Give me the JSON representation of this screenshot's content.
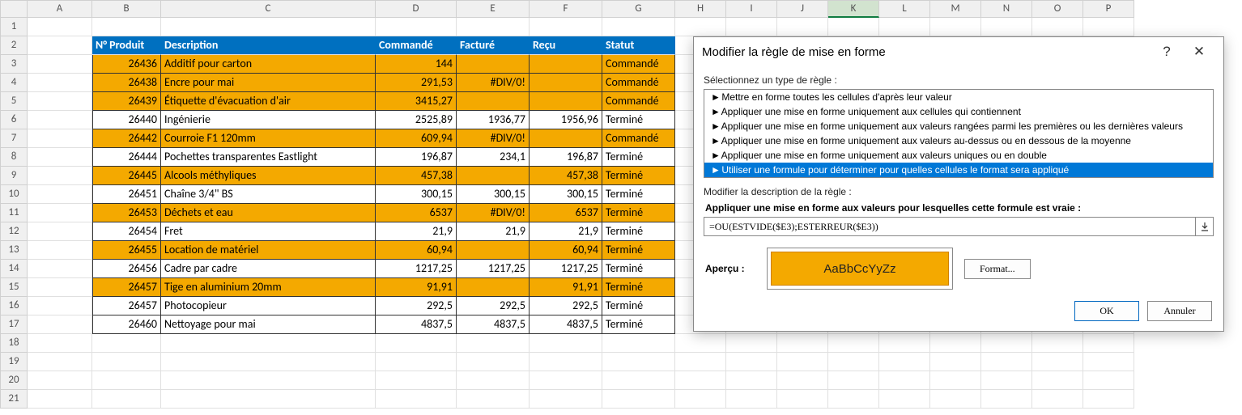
{
  "columns": [
    "A",
    "B",
    "C",
    "D",
    "E",
    "F",
    "G",
    "H",
    "I",
    "J",
    "K",
    "L",
    "M",
    "N",
    "O",
    "P"
  ],
  "selected_column": "K",
  "headers": {
    "B": "N° Produit",
    "C": "Description",
    "D": "Commandé",
    "E": "Facturé",
    "F": "Reçu",
    "G": "Statut"
  },
  "rows": [
    {
      "n": "26436",
      "desc": "Additif pour carton",
      "cmd": "144",
      "fac": "",
      "recu": "",
      "stat": "Commandé",
      "hl": true
    },
    {
      "n": "26438",
      "desc": "Encre pour mai",
      "cmd": "291,53",
      "fac": "#DIV/0!",
      "recu": "",
      "stat": "Commandé",
      "hl": true
    },
    {
      "n": "26439",
      "desc": "Étiquette d'évacuation d'air",
      "cmd": "3415,27",
      "fac": "",
      "recu": "",
      "stat": "Commandé",
      "hl": true
    },
    {
      "n": "26440",
      "desc": "Ingénierie",
      "cmd": "2525,89",
      "fac": "1936,77",
      "recu": "1956,96",
      "stat": "Terminé",
      "hl": false
    },
    {
      "n": "26442",
      "desc": "Courroie F1 120mm",
      "cmd": "609,94",
      "fac": "#DIV/0!",
      "recu": "",
      "stat": "Commandé",
      "hl": true
    },
    {
      "n": "26444",
      "desc": "Pochettes transparentes Eastlight",
      "cmd": "196,87",
      "fac": "234,1",
      "recu": "196,87",
      "stat": "Terminé",
      "hl": false
    },
    {
      "n": "26445",
      "desc": "Alcools méthyliques",
      "cmd": "457,38",
      "fac": "",
      "recu": "457,38",
      "stat": "Terminé",
      "hl": true
    },
    {
      "n": "26451",
      "desc": "Chaîne 3/4\" BS",
      "cmd": "300,15",
      "fac": "300,15",
      "recu": "300,15",
      "stat": "Terminé",
      "hl": false
    },
    {
      "n": "26453",
      "desc": "Déchets et eau",
      "cmd": "6537",
      "fac": "#DIV/0!",
      "recu": "6537",
      "stat": "Terminé",
      "hl": true
    },
    {
      "n": "26454",
      "desc": "Fret",
      "cmd": "21,9",
      "fac": "21,9",
      "recu": "21,9",
      "stat": "Terminé",
      "hl": false
    },
    {
      "n": "26455",
      "desc": "Location de matériel",
      "cmd": "60,94",
      "fac": "",
      "recu": "60,94",
      "stat": "Terminé",
      "hl": true
    },
    {
      "n": "26456",
      "desc": "Cadre par cadre",
      "cmd": "1217,25",
      "fac": "1217,25",
      "recu": "1217,25",
      "stat": "Terminé",
      "hl": false
    },
    {
      "n": "26457",
      "desc": "Tige en aluminium 20mm",
      "cmd": "91,91",
      "fac": "",
      "recu": "91,91",
      "stat": "Terminé",
      "hl": true
    },
    {
      "n": "26457",
      "desc": "Photocopieur",
      "cmd": "292,5",
      "fac": "292,5",
      "recu": "292,5",
      "stat": "Terminé",
      "hl": false
    },
    {
      "n": "26460",
      "desc": "Nettoyage pour mai",
      "cmd": "4837,5",
      "fac": "4837,5",
      "recu": "4837,5",
      "stat": "Terminé",
      "hl": false
    }
  ],
  "dialog": {
    "title": "Modifier la règle de mise en forme",
    "help": "?",
    "close": "✕",
    "select_label": "Sélectionnez un type de règle :",
    "rules": [
      "Mettre en forme toutes les cellules d'après leur valeur",
      "Appliquer une mise en forme uniquement aux cellules qui contiennent",
      "Appliquer une mise en forme uniquement aux valeurs rangées parmi les premières ou les dernières valeurs",
      "Appliquer une mise en forme uniquement aux valeurs au-dessus ou en dessous de la moyenne",
      "Appliquer une mise en forme uniquement aux valeurs uniques ou en double",
      "Utiliser une formule pour déterminer pour quelles cellules le format sera appliqué"
    ],
    "selected_rule": 5,
    "desc_label": "Modifier la description de la règle :",
    "formula_label": "Appliquer une mise en forme aux valeurs pour lesquelles cette formule est vraie :",
    "formula": "=OU(ESTVIDE($E3);ESTERREUR($E3))",
    "preview_label": "Aperçu :",
    "preview_text": "AaBbCcYyZz",
    "format_btn": "Format...",
    "ok": "OK",
    "cancel": "Annuler"
  }
}
